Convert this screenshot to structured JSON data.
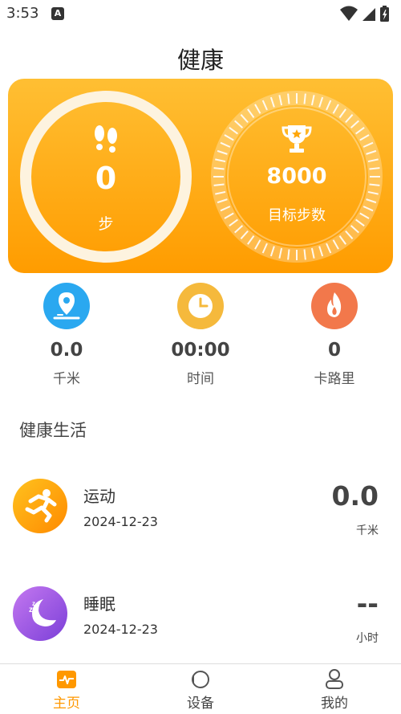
{
  "status_bar": {
    "time": "3:53",
    "notification_glyph": "A"
  },
  "page": {
    "title": "健康"
  },
  "steps_card": {
    "steps_value": "0",
    "steps_label": "步",
    "goal_value": "8000",
    "goal_label": "目标步数",
    "gradient_top": "#ffbf33",
    "gradient_bottom": "#ff9c00"
  },
  "stats": [
    {
      "value": "0.0",
      "label": "千米",
      "icon": "location-pin-icon",
      "color": "#2aa8f0"
    },
    {
      "value": "00:00",
      "label": "时间",
      "icon": "clock-icon",
      "color": "#f5b93c"
    },
    {
      "value": "0",
      "label": "卡路里",
      "icon": "flame-icon",
      "color": "#f2784b"
    }
  ],
  "section_title": "健康生活",
  "activities": [
    {
      "name": "运动",
      "date": "2024-12-23",
      "value": "0.0",
      "unit": "千米",
      "icon": "running-person-icon"
    },
    {
      "name": "睡眠",
      "date": "2024-12-23",
      "value": "--",
      "unit": "小时",
      "icon": "moon-sleep-icon"
    }
  ],
  "tabs": [
    {
      "label": "主页",
      "icon": "heartbeat-icon",
      "active": true
    },
    {
      "label": "设备",
      "icon": "watch-icon",
      "active": false
    },
    {
      "label": "我的",
      "icon": "person-icon",
      "active": false
    }
  ],
  "accent_color": "#ff9800"
}
